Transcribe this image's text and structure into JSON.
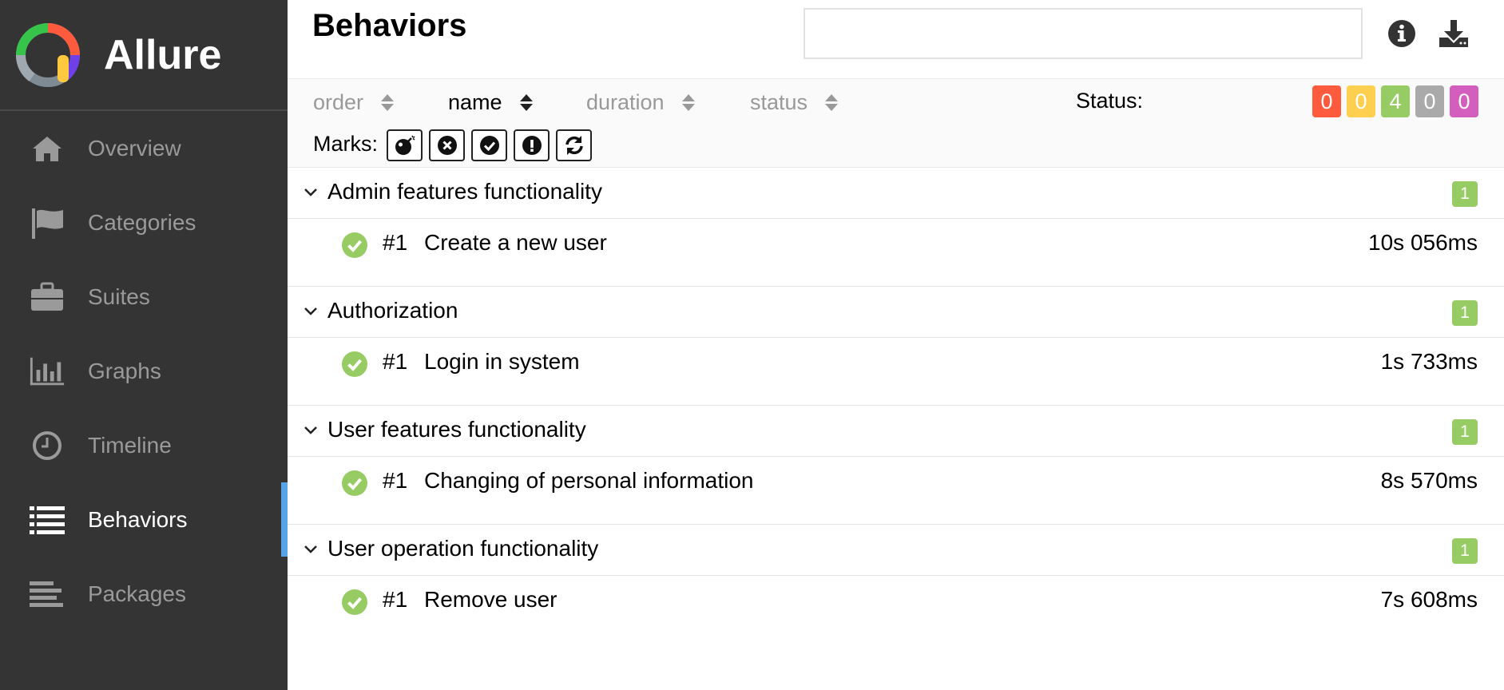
{
  "app": {
    "name": "Allure"
  },
  "sidebar": {
    "items": [
      {
        "label": "Overview",
        "icon": "home-icon",
        "active": false
      },
      {
        "label": "Categories",
        "icon": "flag-icon",
        "active": false
      },
      {
        "label": "Suites",
        "icon": "briefcase-icon",
        "active": false
      },
      {
        "label": "Graphs",
        "icon": "bar-chart-icon",
        "active": false
      },
      {
        "label": "Timeline",
        "icon": "clock-icon",
        "active": false
      },
      {
        "label": "Behaviors",
        "icon": "list-icon",
        "active": true
      },
      {
        "label": "Packages",
        "icon": "align-left-icon",
        "active": false
      }
    ]
  },
  "header": {
    "title": "Behaviors",
    "search_value": "",
    "icons": [
      "info-icon",
      "download-icon"
    ]
  },
  "sort": {
    "columns": [
      {
        "label": "order",
        "active": false
      },
      {
        "label": "name",
        "active": true
      },
      {
        "label": "duration",
        "active": false
      },
      {
        "label": "status",
        "active": false
      }
    ]
  },
  "status_filter": {
    "label": "Status:",
    "counts": [
      {
        "value": "0",
        "color": "#fd5a3e"
      },
      {
        "value": "0",
        "color": "#ffd050"
      },
      {
        "value": "4",
        "color": "#97cc64"
      },
      {
        "value": "0",
        "color": "#aaaaaa"
      },
      {
        "value": "0",
        "color": "#d35ebe"
      }
    ]
  },
  "marks": {
    "label": "Marks:",
    "icons": [
      "bomb-icon",
      "times-circle-icon",
      "check-circle-icon",
      "exclamation-circle-icon",
      "refresh-icon"
    ]
  },
  "groups": [
    {
      "name": "Admin features functionality",
      "count": "1",
      "case": {
        "num": "#1",
        "name": "Create a new user",
        "duration": "10s 056ms",
        "status_color": "#97cc64"
      }
    },
    {
      "name": "Authorization",
      "count": "1",
      "case": {
        "num": "#1",
        "name": "Login in system",
        "duration": "1s 733ms",
        "status_color": "#97cc64"
      }
    },
    {
      "name": "User features functionality",
      "count": "1",
      "case": {
        "num": "#1",
        "name": "Changing of personal information",
        "duration": "8s 570ms",
        "status_color": "#97cc64"
      }
    },
    {
      "name": "User operation functionality",
      "count": "1",
      "case": {
        "num": "#1",
        "name": "Remove user",
        "duration": "7s 608ms",
        "status_color": "#97cc64"
      }
    }
  ]
}
